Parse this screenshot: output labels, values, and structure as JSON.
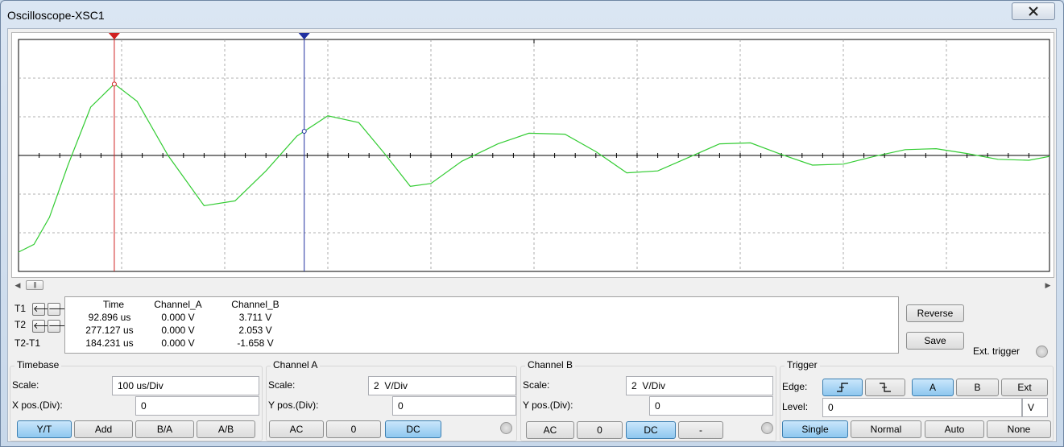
{
  "window": {
    "title": "Oscilloscope-XSC1"
  },
  "icons": {
    "close": "close-icon"
  },
  "screen": {
    "background": "#ffffff",
    "trace_color": "#33cc33",
    "cursor1_color": "#d02020",
    "cursor2_color": "#2030a0",
    "cursor1_time_us": 92.896,
    "cursor2_time_us": 277.127
  },
  "chart_data": {
    "type": "line",
    "xlabel": "",
    "ylabel": "",
    "x_units": "us",
    "y_units": "V",
    "time_per_div_us": 100,
    "volts_per_div": 2,
    "xlim": [
      0,
      1000
    ],
    "ylim": [
      -6,
      6
    ],
    "series": [
      {
        "x": [
          0,
          15,
          30,
          48,
          70,
          93,
          115,
          145,
          180,
          210,
          240,
          270,
          300,
          330,
          355,
          380,
          400,
          430,
          465,
          495,
          530,
          560,
          590,
          620,
          650,
          680,
          710,
          740,
          770,
          800,
          830,
          860,
          890,
          920,
          950,
          980,
          1000
        ],
        "y": [
          -5.0,
          -4.6,
          -3.2,
          -0.5,
          2.5,
          3.7,
          2.8,
          0.0,
          -2.6,
          -2.35,
          -0.8,
          1.0,
          2.05,
          1.7,
          0.1,
          -1.6,
          -1.45,
          -0.3,
          0.6,
          1.15,
          1.1,
          0.2,
          -0.9,
          -0.8,
          -0.1,
          0.6,
          0.65,
          0.05,
          -0.5,
          -0.45,
          -0.05,
          0.3,
          0.35,
          0.1,
          -0.2,
          -0.25,
          -0.05
        ]
      }
    ]
  },
  "readout": {
    "headers": {
      "time": "Time",
      "channel_a": "Channel_A",
      "channel_b": "Channel_B"
    },
    "rows": [
      {
        "label": "T1",
        "time": "92.896 us",
        "channel_a": "0.000 V",
        "channel_b": "3.711 V"
      },
      {
        "label": "T2",
        "time": "277.127 us",
        "channel_a": "0.000 V",
        "channel_b": "2.053 V"
      },
      {
        "label": "T2-T1",
        "time": "184.231 us",
        "channel_a": "0.000 V",
        "channel_b": "-1.658 V"
      }
    ]
  },
  "buttons": {
    "reverse": "Reverse",
    "save": "Save"
  },
  "ext_trigger": {
    "label": "Ext. trigger"
  },
  "timebase": {
    "title": "Timebase",
    "scale_label": "Scale:",
    "scale_value": "100 us/Div",
    "xpos_label": "X pos.(Div):",
    "xpos_value": "0",
    "modes": [
      "Y/T",
      "Add",
      "B/A",
      "A/B"
    ],
    "active_mode": "Y/T"
  },
  "channel_a": {
    "title": "Channel A",
    "scale_label": "Scale:",
    "scale_value": "2  V/Div",
    "ypos_label": "Y pos.(Div):",
    "ypos_value": "0",
    "coupling": [
      "AC",
      "0",
      "DC"
    ],
    "active_coupling": "DC"
  },
  "channel_b": {
    "title": "Channel B",
    "scale_label": "Scale:",
    "scale_value": "2  V/Div",
    "ypos_label": "Y pos.(Div):",
    "ypos_value": "0",
    "coupling": [
      "AC",
      "0",
      "DC",
      "-"
    ],
    "active_coupling": "DC"
  },
  "trigger": {
    "title": "Trigger",
    "edge_label": "Edge:",
    "edge_icons": [
      "rising-edge-icon",
      "falling-edge-icon"
    ],
    "sources": [
      "A",
      "B",
      "Ext"
    ],
    "active_source": "A",
    "level_label": "Level:",
    "level_value": "0",
    "level_unit": "V",
    "modes": [
      "Single",
      "Normal",
      "Auto",
      "None"
    ],
    "active_mode": "Single"
  }
}
